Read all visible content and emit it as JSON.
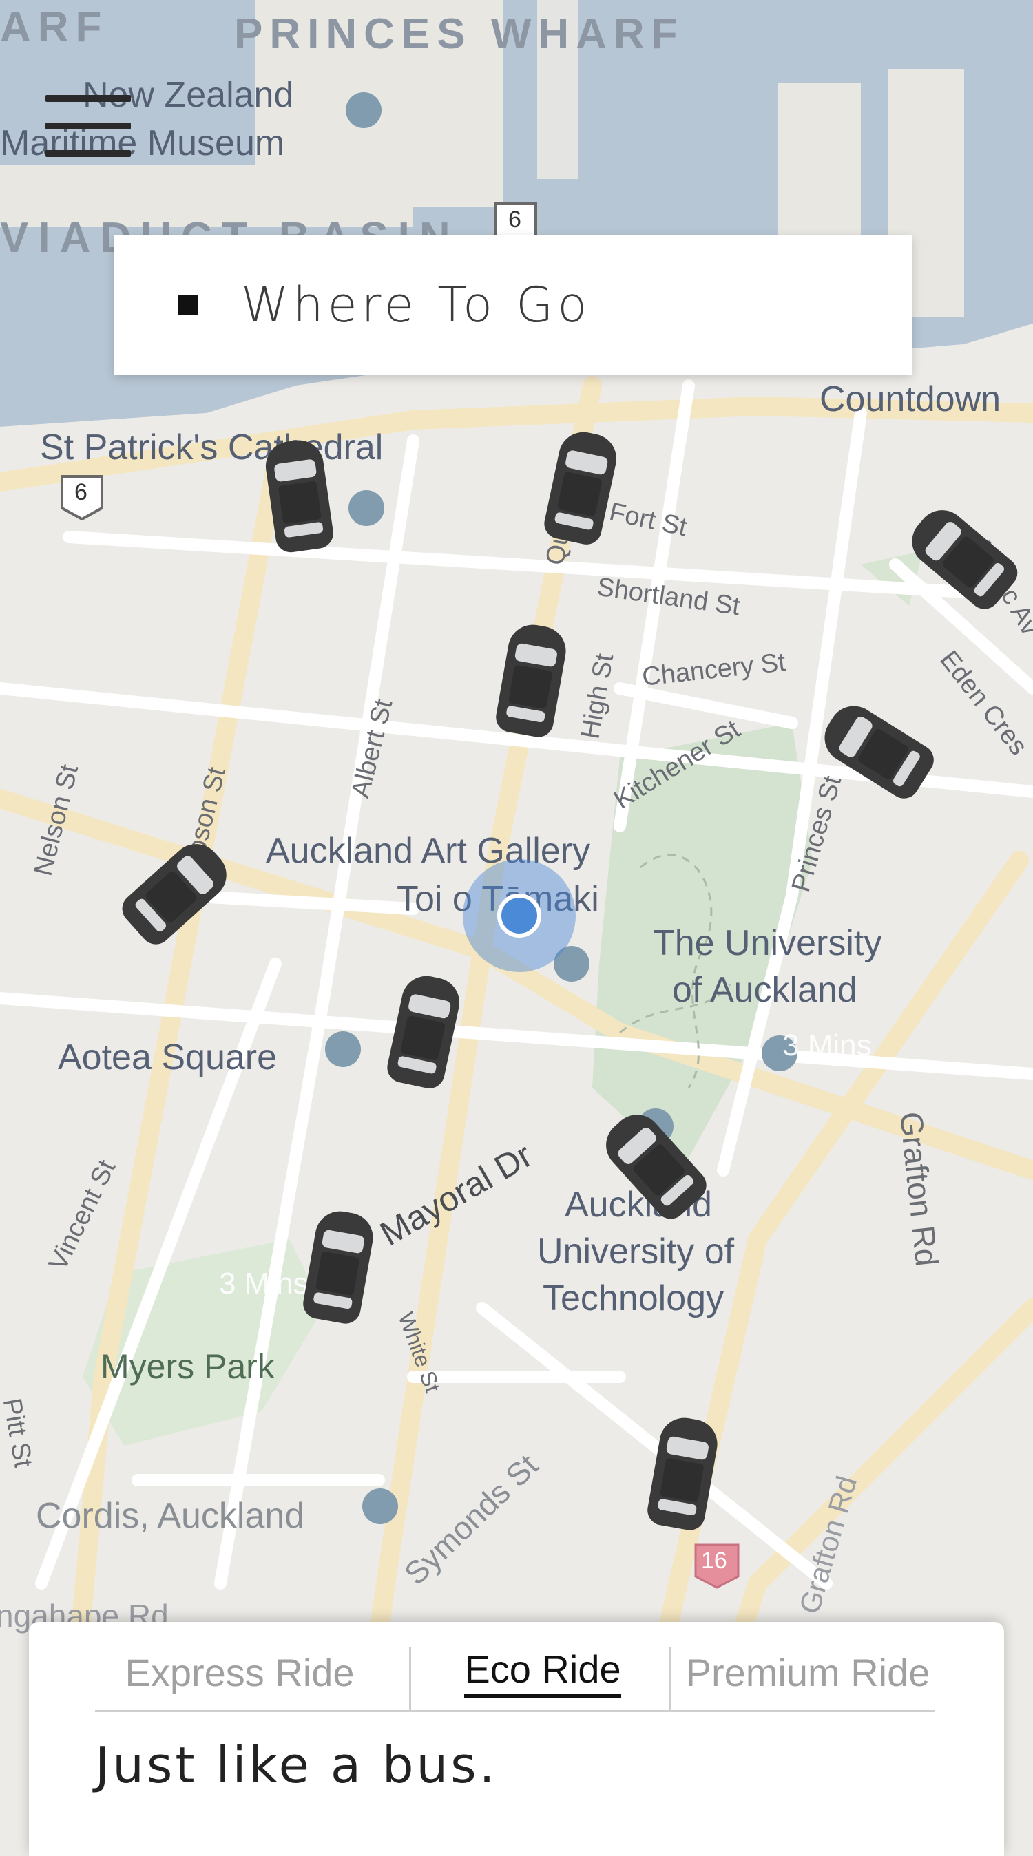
{
  "map": {
    "water_labels": [
      "ARF",
      "PRINCES WHARF",
      "VIADUCT BASIN"
    ],
    "poi_labels": {
      "maritime_museum_l1": "New Zealand",
      "maritime_museum_l2": "Maritime Museum",
      "countdown": "Countdown",
      "cathedral": "St Patrick's Cathedral",
      "art_gallery_l1": "Auckland Art Gallery",
      "art_gallery_l2": "Toi o Tāmaki",
      "university_l1": "The University",
      "university_l2": "of Auckland",
      "aotea": "Aotea Square",
      "aut_l1": "Auckland",
      "aut_l2": "University of",
      "aut_l3": "Technology",
      "myers_park": "Myers Park",
      "cordis": "Cordis, Auckland"
    },
    "street_labels": {
      "fort": "Fort St",
      "shortland": "Shortland St",
      "chancery": "Chancery St",
      "kitchener": "Kitchener St",
      "queen": "Queen St",
      "high": "High St",
      "albert": "Albert St",
      "hobson": "Hobson St",
      "nelson": "Nelson St",
      "princes": "Princes St",
      "eden": "Eden Cres",
      "anzac": "Anzac Av",
      "grafton": "Grafton Rd",
      "mayoral": "Mayoral Dr",
      "vincent": "Vincent St",
      "white": "White St",
      "pitt": "Pitt St",
      "symonds": "Symonds St",
      "grafton2": "Grafton Rd",
      "wellesley": "ngahape Rd"
    },
    "route_shields": [
      "6",
      "6",
      "16"
    ],
    "eta_labels": [
      "3 Mins",
      "3 Mins"
    ]
  },
  "search": {
    "placeholder": "Where To Go"
  },
  "ride_options": {
    "tabs": [
      "Express Ride",
      "Eco Ride",
      "Premium Ride"
    ],
    "selected": "Eco Ride",
    "description": "Just like a bus."
  },
  "colors": {
    "user_location": "#4a8ad6",
    "map_background": "#ecebe7",
    "water": "#aebfcf",
    "park": "#cfdfca"
  },
  "icons": {
    "menu": "hamburger-menu-icon",
    "search": "square-icon",
    "car": "car-icon",
    "location": "user-location-icon"
  }
}
